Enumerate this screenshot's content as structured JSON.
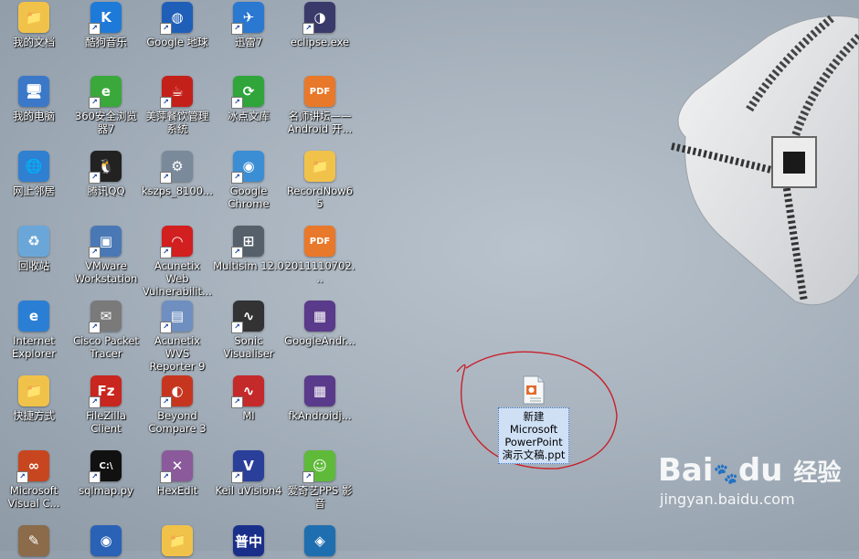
{
  "desktop": {
    "icons": [
      {
        "label": "我的文档",
        "icon": "folder-docs-icon",
        "color": "#f1c24a",
        "glyph": "📁",
        "shortcut": false
      },
      {
        "label": "我的电脑",
        "icon": "computer-icon",
        "color": "#3b78c8",
        "glyph": "🖥",
        "shortcut": false
      },
      {
        "label": "网上邻居",
        "icon": "network-icon",
        "color": "#2f80d0",
        "glyph": "🌐",
        "shortcut": false
      },
      {
        "label": "回收站",
        "icon": "recycle-bin-icon",
        "color": "#6aa7d8",
        "glyph": "♻",
        "shortcut": false
      },
      {
        "label": "Internet Explorer",
        "icon": "ie-icon",
        "color": "#2a7fd4",
        "glyph": "e",
        "shortcut": false
      },
      {
        "label": "快捷方式",
        "icon": "folder-icon",
        "color": "#f1c24a",
        "glyph": "📁",
        "shortcut": false
      },
      {
        "label": "Microsoft Visual C...",
        "icon": "visual-c-icon",
        "color": "#c8461f",
        "glyph": "∞",
        "shortcut": true
      },
      {
        "label": "",
        "icon": "tool-icon",
        "color": "#8b6b4a",
        "glyph": "✎",
        "shortcut": false
      },
      {
        "label": "酷狗音乐",
        "icon": "kugou-icon",
        "color": "#1e7ad8",
        "glyph": "K",
        "shortcut": true
      },
      {
        "label": "360安全浏览器7",
        "icon": "360-browser-icon",
        "color": "#3aa83a",
        "glyph": "e",
        "shortcut": true
      },
      {
        "label": "腾讯QQ",
        "icon": "qq-icon",
        "color": "#222222",
        "glyph": "🐧",
        "shortcut": true
      },
      {
        "label": "VMware Workstation",
        "icon": "vmware-icon",
        "color": "#4a78b5",
        "glyph": "▣",
        "shortcut": true
      },
      {
        "label": "Cisco Packet Tracer",
        "icon": "cisco-icon",
        "color": "#7a7a7a",
        "glyph": "✉",
        "shortcut": true
      },
      {
        "label": "FileZilla Client",
        "icon": "filezilla-icon",
        "color": "#c8261e",
        "glyph": "Fz",
        "shortcut": true
      },
      {
        "label": "sqlmap.py",
        "icon": "sqlmap-icon",
        "color": "#111111",
        "glyph": "C:\\",
        "shortcut": true
      },
      {
        "label": "",
        "icon": "globe-icon",
        "color": "#2a62b5",
        "glyph": "◉",
        "shortcut": false
      },
      {
        "label": "Google 地球",
        "icon": "google-earth-icon",
        "color": "#1f5fb8",
        "glyph": "◍",
        "shortcut": true
      },
      {
        "label": "美萍餐饮管理系统",
        "icon": "meiping-icon",
        "color": "#c4201a",
        "glyph": "☕",
        "shortcut": true
      },
      {
        "label": "kszps_8100...",
        "icon": "kszps-icon",
        "color": "#7a8a9a",
        "glyph": "⚙",
        "shortcut": true
      },
      {
        "label": "Acunetix Web Vulnerabilit...",
        "icon": "acunetix-icon",
        "color": "#d21f1f",
        "glyph": "◠",
        "shortcut": true
      },
      {
        "label": "Acunetix WVS Reporter 9",
        "icon": "acunetix-reporter-icon",
        "color": "#6f8fc0",
        "glyph": "▤",
        "shortcut": true
      },
      {
        "label": "Beyond Compare 3",
        "icon": "beyond-compare-icon",
        "color": "#c6361f",
        "glyph": "◐",
        "shortcut": true
      },
      {
        "label": "HexEdit",
        "icon": "hexedit-icon",
        "color": "#8a5a9a",
        "glyph": "✕",
        "shortcut": true
      },
      {
        "label": "",
        "icon": "folder-icon",
        "color": "#f1c24a",
        "glyph": "📁",
        "shortcut": false
      },
      {
        "label": "迅雷7",
        "icon": "xunlei-icon",
        "color": "#2a78d0",
        "glyph": "✈",
        "shortcut": true
      },
      {
        "label": "冰点文库",
        "icon": "bingdian-icon",
        "color": "#2fa53a",
        "glyph": "⟳",
        "shortcut": true
      },
      {
        "label": "Google Chrome",
        "icon": "chrome-icon",
        "color": "#3b8ed4",
        "glyph": "◉",
        "shortcut": true
      },
      {
        "label": "Multisim 12.0",
        "icon": "multisim-icon",
        "color": "#55606b",
        "glyph": "⊞",
        "shortcut": true
      },
      {
        "label": "Sonic Visualiser",
        "icon": "sonic-visualiser-icon",
        "color": "#333333",
        "glyph": "∿",
        "shortcut": true
      },
      {
        "label": "MI",
        "icon": "mi-icon",
        "color": "#c42a2a",
        "glyph": "∿",
        "shortcut": true
      },
      {
        "label": "Keil uVision4",
        "icon": "keil-icon",
        "color": "#2a3f9a",
        "glyph": "V",
        "shortcut": true
      },
      {
        "label": "",
        "icon": "app-icon",
        "color": "#1a2f8a",
        "glyph": "普中",
        "shortcut": false
      },
      {
        "label": "eclipse.exe",
        "icon": "eclipse-icon",
        "color": "#3a3a6a",
        "glyph": "◑",
        "shortcut": true
      },
      {
        "label": "名师讲坛——Android 开...",
        "icon": "pdf-icon",
        "color": "#e8782a",
        "glyph": "PDF",
        "shortcut": false
      },
      {
        "label": "RecordNow65",
        "icon": "folder-icon",
        "color": "#f1c24a",
        "glyph": "📁",
        "shortcut": false
      },
      {
        "label": "2011110702...",
        "icon": "pdf-icon",
        "color": "#e8782a",
        "glyph": "PDF",
        "shortcut": false
      },
      {
        "label": "GoogleAndr...",
        "icon": "rar-icon",
        "color": "#5a3a8a",
        "glyph": "▦",
        "shortcut": false
      },
      {
        "label": "fkAndroidj...",
        "icon": "rar-icon",
        "color": "#5a3a8a",
        "glyph": "▦",
        "shortcut": false
      },
      {
        "label": "爱奇艺PPS 影音",
        "icon": "iqiyi-icon",
        "color": "#5fba3a",
        "glyph": "☺",
        "shortcut": true
      },
      {
        "label": "",
        "icon": "app-icon",
        "color": "#1f6fb0",
        "glyph": "◈",
        "shortcut": false
      }
    ],
    "selected_file": {
      "label": "新建 Microsoft PowerPoint 演示文稿.ppt",
      "icon": "powerpoint-file-icon"
    }
  },
  "watermark": {
    "logo": "Bai",
    "logo_paw": "du",
    "logo_cn": "经验",
    "url": "jingyan.baidu.com"
  }
}
